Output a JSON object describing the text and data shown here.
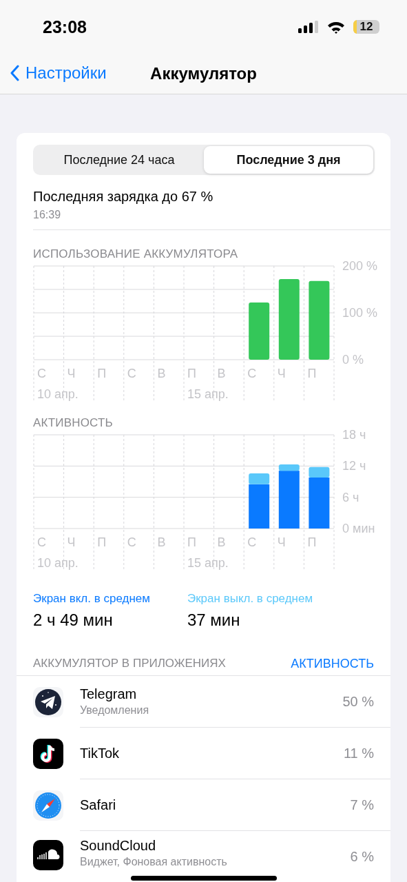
{
  "status_bar": {
    "time": "23:08",
    "battery": "12"
  },
  "nav": {
    "back": "Настройки",
    "title": "Аккумулятор"
  },
  "tabs": [
    {
      "label": "Последние 24 часа",
      "selected": false
    },
    {
      "label": "Последние 3 дня",
      "selected": true
    }
  ],
  "last_charge": {
    "title": "Последняя зарядка до 67 %",
    "time": "16:39"
  },
  "usage": {
    "title": "ИСПОЛЬЗОВАНИЕ АККУМУЛЯТОРА",
    "chart_data": {
      "type": "bar",
      "categories": [
        "С",
        "Ч",
        "П",
        "С",
        "В",
        "П",
        "В",
        "С",
        "Ч",
        "П"
      ],
      "series": [
        {
          "color": "#34c759",
          "values": [
            null,
            null,
            null,
            null,
            null,
            null,
            null,
            122,
            172,
            168
          ]
        }
      ],
      "ylim": [
        0,
        200
      ],
      "yticks": [
        {
          "value": 0,
          "label": "0 %"
        },
        {
          "value": 100,
          "label": "100 %"
        },
        {
          "value": 200,
          "label": "200 %"
        }
      ],
      "annotations": [
        "10 апр.",
        "15 апр."
      ]
    }
  },
  "activity": {
    "title": "АКТИВНОСТЬ",
    "chart_data": {
      "type": "bar",
      "stacked": true,
      "categories": [
        "С",
        "Ч",
        "П",
        "С",
        "В",
        "П",
        "В",
        "С",
        "Ч",
        "П"
      ],
      "series": [
        {
          "color": "#0a7aff",
          "values": [
            null,
            null,
            null,
            null,
            null,
            null,
            null,
            8.5,
            11.1,
            9.8
          ]
        },
        {
          "color": "#5ac8fa",
          "values": [
            null,
            null,
            null,
            null,
            null,
            null,
            null,
            2.1,
            1.2,
            2.0
          ]
        }
      ],
      "ylim": [
        0,
        18
      ],
      "yticks": [
        {
          "value": 0,
          "label": "0 мин"
        },
        {
          "value": 6,
          "label": "6 ч"
        },
        {
          "value": 12,
          "label": "12 ч"
        },
        {
          "value": 18,
          "label": "18 ч"
        }
      ],
      "annotations": [
        "10 апр.",
        "15 апр."
      ]
    }
  },
  "averages": [
    {
      "label": "Экран вкл. в среднем",
      "value": "2 ч 49 мин",
      "color": "#0a7aff"
    },
    {
      "label": "Экран выкл. в среднем",
      "value": "37 мин",
      "color": "#5ac8fa"
    }
  ],
  "apps_section": {
    "title": "АККУМУЛЯТОР В ПРИЛОЖЕНИЯХ",
    "action": "АКТИВНОСТЬ"
  },
  "apps": [
    {
      "name": "Telegram",
      "detail": "Уведомления",
      "percent": "50 %",
      "kind": "telegram"
    },
    {
      "name": "TikTok",
      "percent": "11 %",
      "kind": "tiktok"
    },
    {
      "name": "Safari",
      "percent": "7 %",
      "kind": "safari"
    },
    {
      "name": "SoundCloud",
      "detail": "Виджет, Фоновая активность",
      "percent": "6 %",
      "kind": "soundcloud"
    }
  ]
}
